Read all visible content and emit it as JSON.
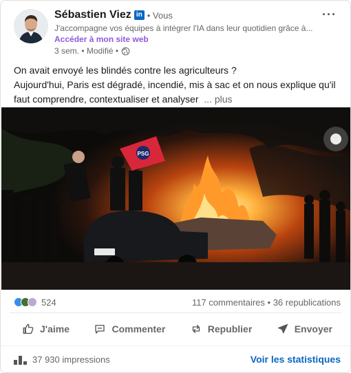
{
  "post": {
    "author_name": "Sébastien Viez",
    "badge": "in",
    "degree": "• Vous",
    "headline": "J'accompagne vos équipes à intégrer l'IA dans leur quotidien grâce à...",
    "site_link": "Accéder à mon site web",
    "meta": "3 sem. • Modifié •",
    "text_line1": "On avait envoyé les blindés contre les agriculteurs ?",
    "text_line2": "Aujourd'hui, Paris est dégradé, incendié, mis à sac et on nous explique qu'il faut comprendre, contextualiser et analyser",
    "see_more": "... plus",
    "more_menu": "···"
  },
  "image": {
    "flag_text": "PSG"
  },
  "social": {
    "reaction_icons": [
      "like-icon",
      "celebrate-icon",
      "support-icon"
    ],
    "reaction_count": "524",
    "comments": "117 commentaires",
    "separator": " • ",
    "reposts": "36 republications"
  },
  "actions": {
    "like": "J'aime",
    "comment": "Commenter",
    "repost": "Republier",
    "send": "Envoyer"
  },
  "footer": {
    "impressions": "37 930 impressions",
    "stats_link": "Voir les statistiques"
  },
  "colors": {
    "accent": "#0a66c2",
    "site_link": "#8f5bd9",
    "like_blue": "#378fe9"
  }
}
